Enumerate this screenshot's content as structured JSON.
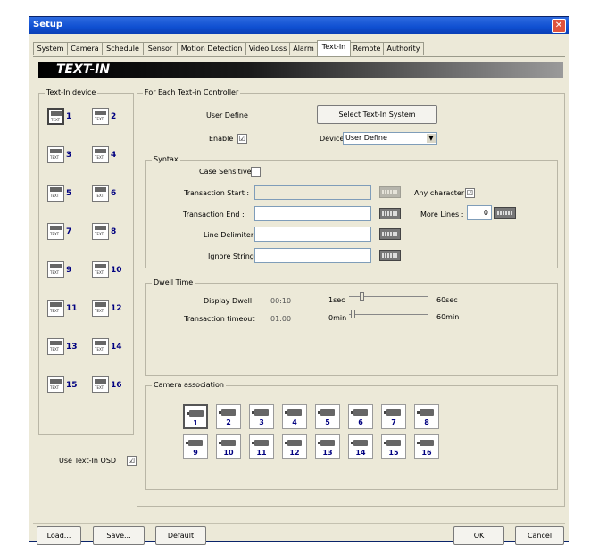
{
  "window": {
    "title": "Setup"
  },
  "tabs": [
    "System",
    "Camera",
    "Schedule",
    "Sensor",
    "Motion Detection",
    "Video Loss",
    "Alarm",
    "Text-In",
    "Remote",
    "Authority"
  ],
  "banner": "TEXT-IN",
  "textin_device": {
    "group_label": "Text-In device",
    "icon_caption": "TEXT",
    "devices": [
      "1",
      "2",
      "3",
      "4",
      "5",
      "6",
      "7",
      "8",
      "9",
      "10",
      "11",
      "12",
      "13",
      "14",
      "15",
      "16"
    ],
    "selected": "1"
  },
  "controller": {
    "group_label": "For Each Text-in Controller",
    "user_define_label": "User Define",
    "select_system_button": "Select Text-In System",
    "enable_label": "Enable",
    "enable_checked": true,
    "device_label": "Device",
    "device_value": "User Define"
  },
  "syntax": {
    "group_label": "Syntax",
    "case_sensitive_label": "Case Sensitive",
    "case_sensitive_checked": false,
    "transaction_start_label": "Transaction Start :",
    "transaction_end_label": "Transaction End :",
    "line_delimiter_label": "Line Delimiter :",
    "ignore_string_label": "Ignore String :",
    "any_character_label": "Any character",
    "any_character_checked": true,
    "more_lines_label": "More Lines :",
    "more_lines_value": "0"
  },
  "dwell": {
    "group_label": "Dwell Time",
    "display_dwell_label": "Display Dwell",
    "display_dwell_value": "00:10",
    "display_min": "1sec",
    "display_max": "60sec",
    "display_level": 0.15,
    "transaction_timeout_label": "Transaction timeout",
    "transaction_timeout_value": "01:00",
    "timeout_min": "0min",
    "timeout_max": "60min",
    "timeout_level": 0.02
  },
  "camera_association": {
    "group_label": "Camera association",
    "cameras": [
      "1",
      "2",
      "3",
      "4",
      "5",
      "6",
      "7",
      "8",
      "9",
      "10",
      "11",
      "12",
      "13",
      "14",
      "15",
      "16"
    ],
    "selected": "1"
  },
  "osd": {
    "label": "Use Text-In OSD",
    "checked": true
  },
  "footer": {
    "load": "Load...",
    "save": "Save...",
    "default": "Default",
    "ok": "OK",
    "cancel": "Cancel"
  },
  "check_mark": "☑",
  "colors": {
    "title_bar": "#0f4fd1",
    "close_button": "#e0533d",
    "device_numbers": "#000080"
  }
}
